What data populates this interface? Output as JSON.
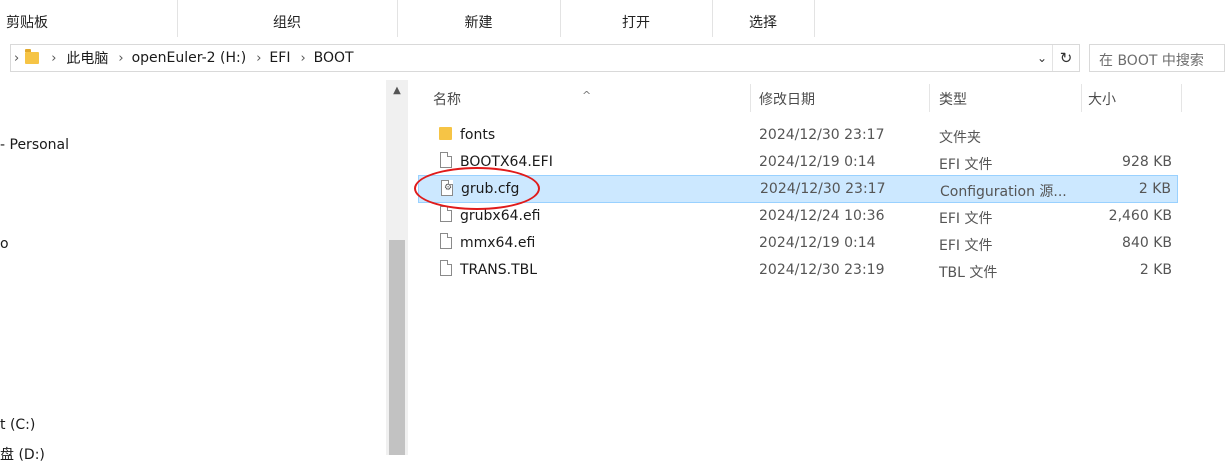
{
  "ribbon": {
    "groups": [
      "剪贴板",
      "组织",
      "新建",
      "打开",
      "选择"
    ]
  },
  "address": {
    "crumbs": [
      "此电脑",
      "openEuler-2 (H:)",
      "EFI",
      "BOOT"
    ],
    "dropdown_icon": "chevron-down-icon",
    "refresh_icon": "refresh-icon"
  },
  "search": {
    "placeholder": "在 BOOT 中搜索"
  },
  "nav": {
    "items": [
      "- Personal",
      "o",
      "t (C:)",
      "‌盘 (D:)"
    ]
  },
  "columns": {
    "name": "名称",
    "date": "修改日期",
    "type": "类型",
    "size": "大小"
  },
  "files": [
    {
      "name": "fonts",
      "date": "2024/12/30 23:17",
      "type": "文件夹",
      "size": "",
      "icon": "folder-icon"
    },
    {
      "name": "BOOTX64.EFI",
      "date": "2024/12/19 0:14",
      "type": "EFI 文件",
      "size": "928 KB",
      "icon": "file-icon"
    },
    {
      "name": "grub.cfg",
      "date": "2024/12/30 23:17",
      "type": "Configuration 源...",
      "size": "2 KB",
      "icon": "config-file-icon"
    },
    {
      "name": "grubx64.efi",
      "date": "2024/12/24 10:36",
      "type": "EFI 文件",
      "size": "2,460 KB",
      "icon": "file-icon"
    },
    {
      "name": "mmx64.efi",
      "date": "2024/12/19 0:14",
      "type": "EFI 文件",
      "size": "840 KB",
      "icon": "file-icon"
    },
    {
      "name": "TRANS.TBL",
      "date": "2024/12/30 23:19",
      "type": "TBL 文件",
      "size": "2 KB",
      "icon": "file-icon"
    }
  ],
  "colors": {
    "selection": "#cce8ff",
    "annotation": "#e01b1b",
    "folder": "#f6c445"
  }
}
